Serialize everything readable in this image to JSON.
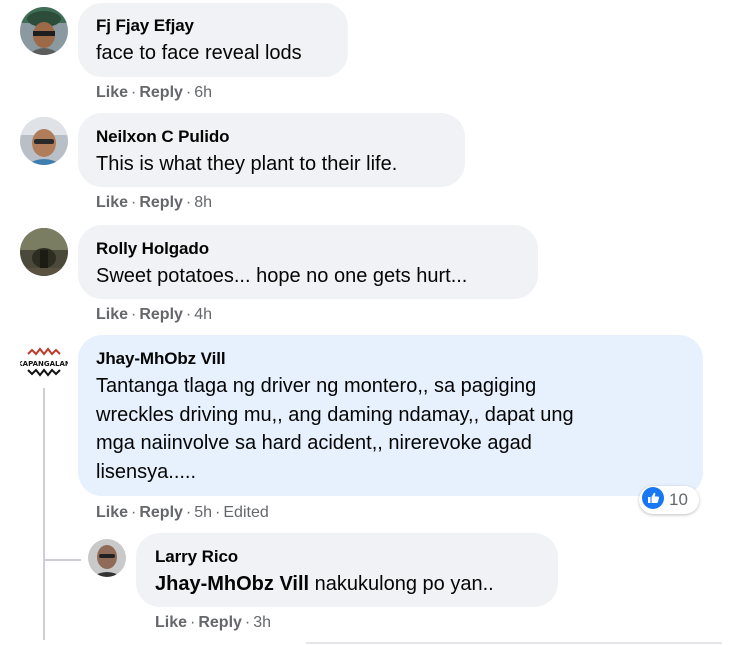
{
  "comments": [
    {
      "author": "Fj Fjay Efjay",
      "text": "face to face reveal lods",
      "like": "Like",
      "reply": "Reply",
      "time": "6h"
    },
    {
      "author": "Neilxon C Pulido",
      "text": "This is what they plant to their life.",
      "like": "Like",
      "reply": "Reply",
      "time": "8h"
    },
    {
      "author": "Rolly Holgado",
      "text": "Sweet potatoes... hope no one gets hurt...",
      "like": "Like",
      "reply": "Reply",
      "time": "4h"
    },
    {
      "author": "Jhay-MhObz Vill",
      "text_lines": [
        "Tantanga tlaga ng driver ng montero,, sa pagiging",
        "wreckles driving mu,, ang daming ndamay,, dapat ung",
        "mga naiinvolve sa hard acident,, nirerevoke agad",
        "lisensya....."
      ],
      "like": "Like",
      "reply": "Reply",
      "time": "5h",
      "edited": "Edited",
      "reaction_count": "10",
      "reaction_icon": "like-icon",
      "avatar_label": "KAPANGALAN"
    },
    {
      "author": "Larry Rico",
      "mention": "Jhay-MhObz Vill",
      "text": "nakukulong po yan..",
      "like": "Like",
      "reply": "Reply",
      "time": "3h"
    }
  ],
  "colors": {
    "bubble": "#f0f2f5",
    "bubble_highlight": "#e7f0fd",
    "meta_text": "#65676b",
    "like_blue": "#1877f2"
  }
}
